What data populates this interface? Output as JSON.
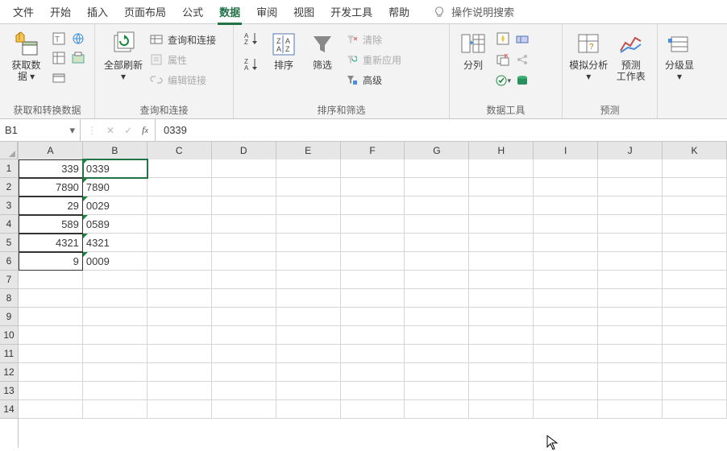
{
  "menubar": {
    "tabs": [
      "文件",
      "开始",
      "插入",
      "页面布局",
      "公式",
      "数据",
      "审阅",
      "视图",
      "开发工具",
      "帮助"
    ],
    "active_index": 5,
    "search_hint": "操作说明搜索"
  },
  "ribbon": {
    "groups": [
      {
        "label": "获取和转换数据",
        "big": {
          "label_line1": "获取数",
          "label_line2": "据"
        }
      },
      {
        "label": "查询和连接",
        "big": {
          "label_line1": "全部刷新"
        },
        "items": [
          "查询和连接",
          "属性",
          "编辑链接"
        ]
      },
      {
        "label": "排序和筛选",
        "sort_asc": "A→Z",
        "sort_desc": "Z→A",
        "sort": "排序",
        "filter": "筛选",
        "clear": "清除",
        "reapply": "重新应用",
        "advanced": "高级"
      },
      {
        "label": "数据工具",
        "text_to_cols": "分列"
      },
      {
        "label": "预测",
        "whatif": "模拟分析",
        "forecast_line1": "预测",
        "forecast_line2": "工作表"
      },
      {
        "label": "",
        "outline": "分级显"
      }
    ]
  },
  "name_box": "B1",
  "formula_value": "0339",
  "columns": [
    "A",
    "B",
    "C",
    "D",
    "E",
    "F",
    "G",
    "H",
    "I",
    "J",
    "K"
  ],
  "rows": [
    1,
    2,
    3,
    4,
    5,
    6,
    7,
    8,
    9,
    10,
    11,
    12,
    13,
    14
  ],
  "data": {
    "A": [
      "339",
      "7890",
      "29",
      "589",
      "4321",
      "9"
    ],
    "B": [
      "0339",
      "7890",
      "0029",
      "0589",
      "4321",
      "0009"
    ]
  },
  "selected_cell": "B1"
}
